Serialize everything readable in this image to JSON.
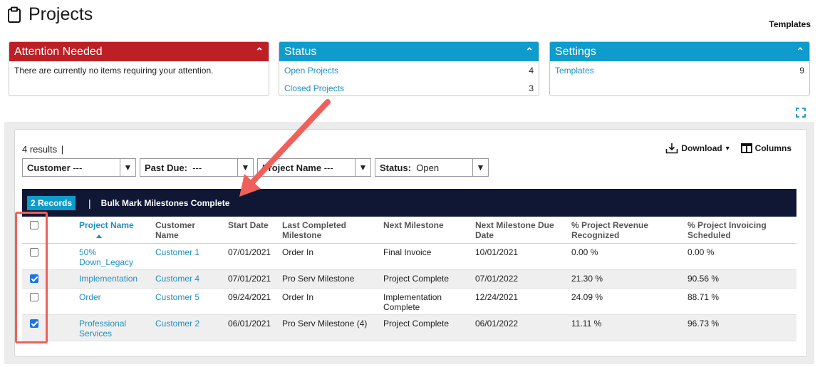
{
  "page": {
    "title": "Projects",
    "templates_link": "Templates"
  },
  "portlets": {
    "attention": {
      "title": "Attention Needed",
      "message": "There are currently no items requiring your attention."
    },
    "status": {
      "title": "Status",
      "rows": [
        {
          "label": "Open Projects",
          "count": "4"
        },
        {
          "label": "Closed Projects",
          "count": "3"
        }
      ]
    },
    "settings": {
      "title": "Settings",
      "rows": [
        {
          "label": "Templates",
          "count": "9"
        }
      ]
    }
  },
  "toolbar": {
    "results": "4 results",
    "results_sep": "|",
    "download": "Download",
    "columns": "Columns"
  },
  "filters": [
    {
      "label": "Customer",
      "value": "---"
    },
    {
      "label": "Past Due:",
      "value": "---"
    },
    {
      "label": "Project Name",
      "value": "---"
    },
    {
      "label": "Status:",
      "value": "Open"
    }
  ],
  "bulk": {
    "records": "2 Records",
    "sep": "|",
    "action": "Bulk Mark Milestones Complete"
  },
  "table": {
    "headers": [
      "Project Name",
      "Customer Name",
      "Start Date",
      "Last Completed Milestone",
      "Next Milestone",
      "Next Milestone Due Date",
      "% Project Revenue Recognized",
      "% Project Invoicing Scheduled"
    ],
    "rows": [
      {
        "checked": false,
        "project": "50% Down_Legacy",
        "customer": "Customer 1",
        "start": "07/01/2021",
        "last": "Order In",
        "next": "Final Invoice",
        "due": "10/01/2021",
        "revenue": "0.00 %",
        "invoicing": "0.00 %"
      },
      {
        "checked": true,
        "project": "Implementation",
        "customer": "Customer 4",
        "start": "07/01/2021",
        "last": "Pro Serv Milestone",
        "next": "Project Complete",
        "due": "07/01/2022",
        "revenue": "21.30 %",
        "invoicing": "90.56 %"
      },
      {
        "checked": false,
        "project": "Order",
        "customer": "Customer 5",
        "start": "09/24/2021",
        "last": "Order In",
        "next": "Implementation Complete",
        "due": "12/24/2021",
        "revenue": "24.09 %",
        "invoicing": "88.71 %"
      },
      {
        "checked": true,
        "project": "Professional Services",
        "customer": "Customer 2",
        "start": "06/01/2021",
        "last": "Pro Serv Milestone (4)",
        "next": "Project Complete",
        "due": "06/01/2022",
        "revenue": "11.11 %",
        "invoicing": "96.73 %"
      }
    ]
  },
  "colors": {
    "attention": "#bc2025",
    "accent": "#0f9bcb",
    "bulkbar": "#101734",
    "link": "#1d8fc0",
    "annotation": "#f0605a"
  }
}
